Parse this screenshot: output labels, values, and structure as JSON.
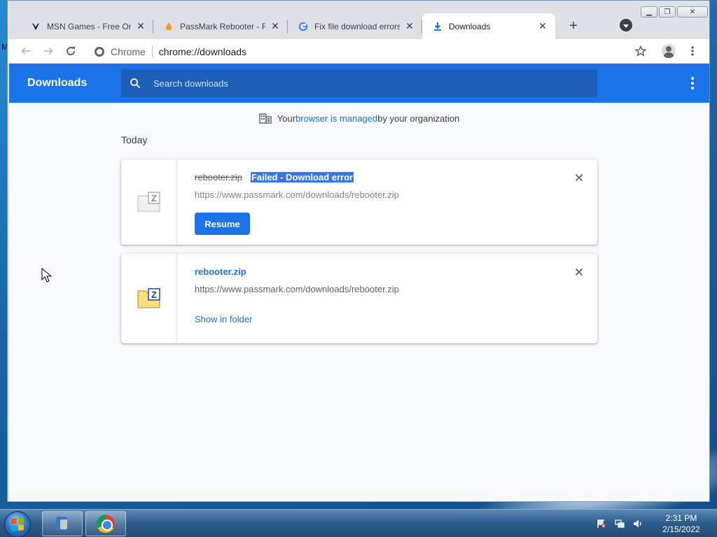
{
  "desktop": {
    "clipped_text": "M"
  },
  "tabs": [
    {
      "title": "MSN Games - Free Online Games",
      "icon": "msn-butterfly-icon",
      "active": false
    },
    {
      "title": "PassMark Rebooter - Reboot",
      "icon": "passmark-flame-icon",
      "active": false
    },
    {
      "title": "Fix file download errors",
      "icon": "google-g-icon",
      "active": false
    },
    {
      "title": "Downloads",
      "icon": "download-arrow-icon",
      "active": true
    }
  ],
  "toolbar": {
    "omnibox_label": "Chrome",
    "url": "chrome://downloads"
  },
  "downloads_page": {
    "title": "Downloads",
    "search_placeholder": "Search downloads",
    "managed_prefix": "Your ",
    "managed_link": "browser is managed",
    "managed_suffix": " by your organization",
    "date_label": "Today"
  },
  "items": [
    {
      "filename": "rebooter.zip",
      "status": "Failed - Download error",
      "url": "https://www.passmark.com/downloads/rebooter.zip",
      "action_label": "Resume",
      "state": "failed"
    },
    {
      "filename": "rebooter.zip",
      "url": "https://www.passmark.com/downloads/rebooter.zip",
      "action_label": "Show in folder",
      "state": "complete"
    }
  ],
  "taskbar": {
    "time": "2:31 PM",
    "date": "2/15/2022"
  },
  "colors": {
    "accent": "#1a73e8",
    "status_highlight": "#3978d8"
  }
}
